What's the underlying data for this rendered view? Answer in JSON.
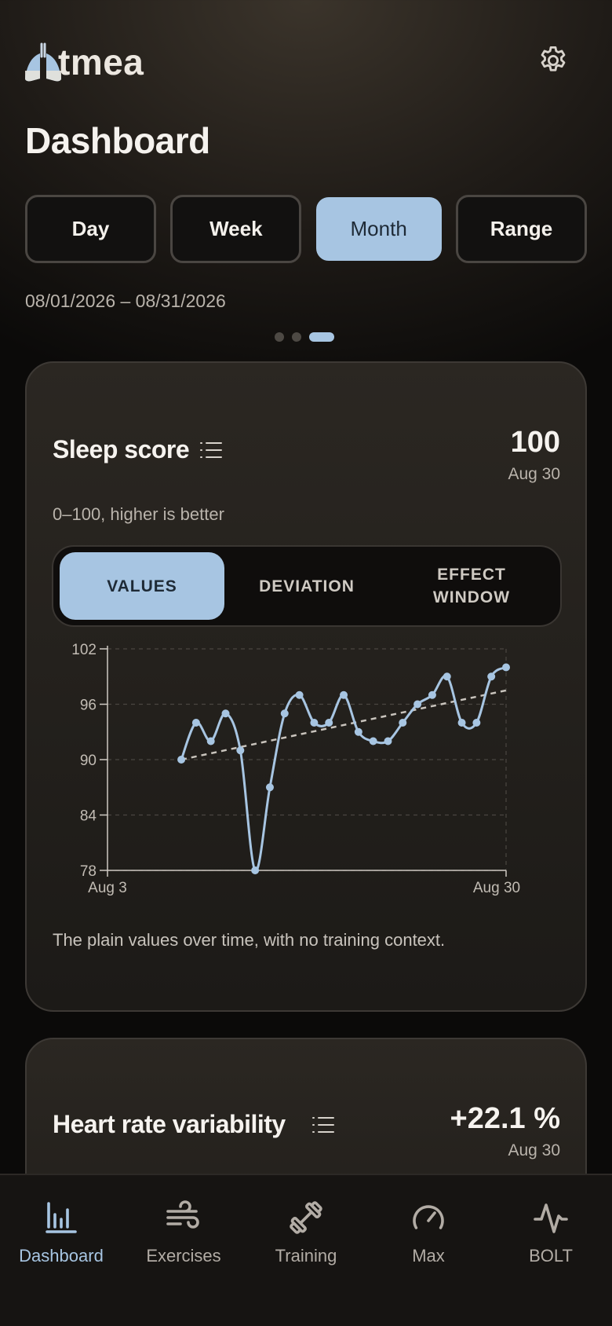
{
  "app": {
    "logo_text": "tmea",
    "logo_alt": "Atmea"
  },
  "header": {
    "title": "Dashboard"
  },
  "period": {
    "options": [
      "Day",
      "Week",
      "Month",
      "Range"
    ],
    "selected": "Month",
    "date_range": "08/01/2026 – 08/31/2026"
  },
  "pager": {
    "count": 3,
    "active": 2
  },
  "sleep_card": {
    "title": "Sleep score",
    "value": "100",
    "date": "Aug 30",
    "subtitle": "0–100, higher is better",
    "tabs": [
      "VALUES",
      "DEVIATION",
      "EFFECT\nWINDOW"
    ],
    "active_tab": 0,
    "footer": "The plain values over time, with no training context."
  },
  "hrv_card": {
    "title": "Heart rate variability",
    "value": "+22.1 %",
    "date": "Aug 30"
  },
  "bottom_nav": [
    {
      "label": "Dashboard",
      "icon": "bar-chart-icon",
      "active": true
    },
    {
      "label": "Exercises",
      "icon": "wind-icon",
      "active": false
    },
    {
      "label": "Training",
      "icon": "dumbbell-icon",
      "active": false
    },
    {
      "label": "Max",
      "icon": "gauge-icon",
      "active": false
    },
    {
      "label": "BOLT",
      "icon": "pulse-icon",
      "active": false
    }
  ],
  "colors": {
    "accent": "#a7c5e2",
    "background": "#1c1a17",
    "text": "#f2efea"
  },
  "chart_data": {
    "type": "line",
    "title": "",
    "xlabel": "",
    "ylabel": "",
    "x_tick_labels": [
      "Aug 3",
      "Aug 30"
    ],
    "y_ticks": [
      78,
      84,
      90,
      96,
      102
    ],
    "ylim": [
      78,
      102
    ],
    "xlim": [
      "2026-08-03",
      "2026-08-30"
    ],
    "grid": true,
    "series": [
      {
        "x": [
          "2026-08-08",
          "2026-08-09",
          "2026-08-10",
          "2026-08-11",
          "2026-08-12",
          "2026-08-13",
          "2026-08-14",
          "2026-08-15",
          "2026-08-16",
          "2026-08-17",
          "2026-08-18",
          "2026-08-19",
          "2026-08-20",
          "2026-08-21",
          "2026-08-22",
          "2026-08-23",
          "2026-08-24",
          "2026-08-25",
          "2026-08-26",
          "2026-08-27",
          "2026-08-28",
          "2026-08-29",
          "2026-08-30"
        ],
        "values": [
          90,
          94,
          92,
          95,
          91,
          78,
          87,
          95,
          97,
          94,
          94,
          97,
          93,
          92,
          92,
          94,
          96,
          97,
          99,
          94,
          94,
          99,
          100
        ],
        "color": "#a7c5e2"
      }
    ],
    "trendline": {
      "x": [
        "2026-08-08",
        "2026-08-30"
      ],
      "values": [
        90,
        97.5
      ],
      "style": "dashed"
    }
  }
}
